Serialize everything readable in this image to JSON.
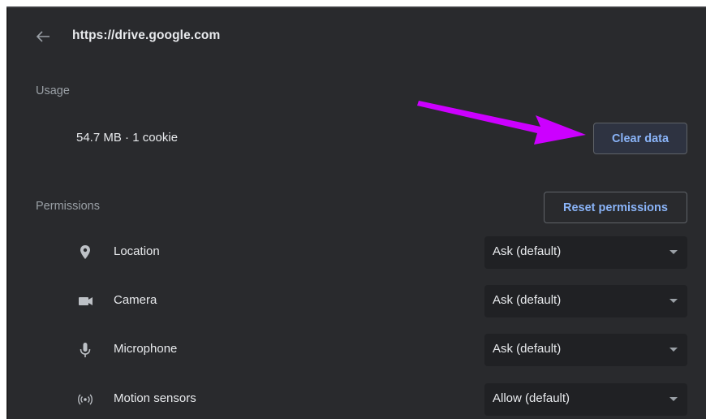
{
  "header": {
    "back_icon": "arrow-left-icon",
    "site_url": "https://drive.google.com"
  },
  "usage": {
    "label": "Usage",
    "value": "54.7 MB · 1 cookie",
    "clear_button_label": "Clear data"
  },
  "annotation": {
    "arrow_color": "#cc00ff"
  },
  "permissions": {
    "label": "Permissions",
    "reset_button_label": "Reset permissions",
    "items": [
      {
        "icon": "location-pin-icon",
        "name": "Location",
        "value": "Ask (default)"
      },
      {
        "icon": "camera-icon",
        "name": "Camera",
        "value": "Ask (default)"
      },
      {
        "icon": "microphone-icon",
        "name": "Microphone",
        "value": "Ask (default)"
      },
      {
        "icon": "motion-sensors-icon",
        "name": "Motion sensors",
        "value": "Allow (default)"
      }
    ]
  },
  "colors": {
    "background": "#292a2d",
    "accent": "#8ab4f8",
    "select_background": "#202124"
  }
}
